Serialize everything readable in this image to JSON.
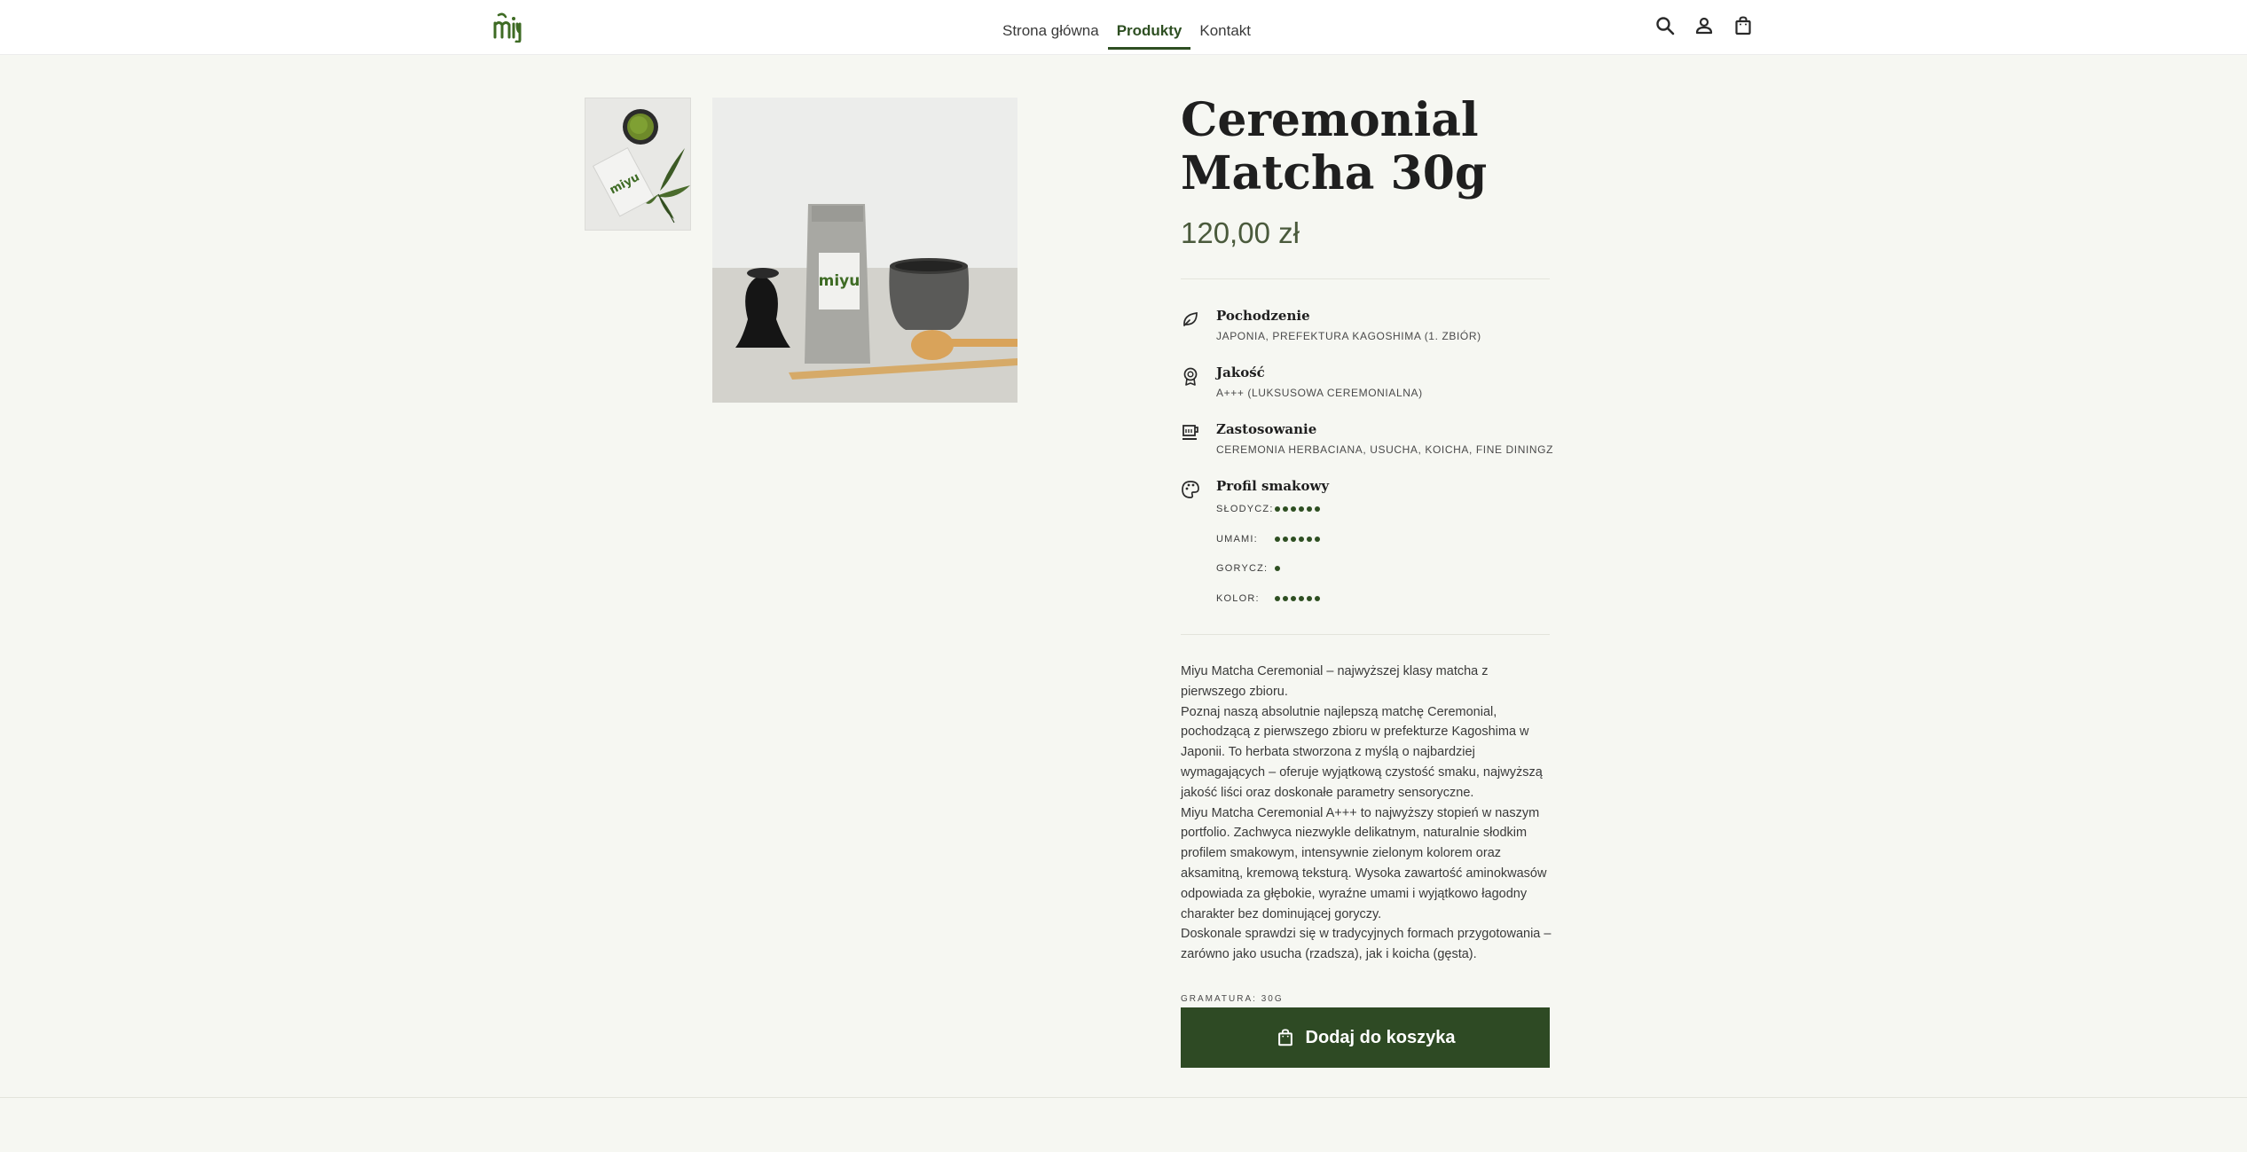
{
  "header": {
    "logo_text": "miyu",
    "nav": [
      {
        "label": "Strona główna",
        "active": false
      },
      {
        "label": "Produkty",
        "active": true
      },
      {
        "label": "Kontakt",
        "active": false
      }
    ],
    "icons": [
      "search-icon",
      "account-icon",
      "cart-icon"
    ]
  },
  "gallery": {
    "thumbnail_icon": "product-photo-thumbnail",
    "main_image_icon": "product-photo-main"
  },
  "product": {
    "title": "Ceremonial Matcha 30g",
    "price": "120,00 zł",
    "features": [
      {
        "icon": "leaf-icon",
        "name": "Pochodzenie",
        "value": "JAPONIA, PREFEKTURA KAGOSHIMA (1. ZBIÓR)"
      },
      {
        "icon": "award-icon",
        "name": "Jakość",
        "value": "A+++ (LUKSUSOWA CEREMONIALNA)"
      },
      {
        "icon": "tea-cup-icon",
        "name": "Zastosowanie",
        "value": "CEREMONIA HERBACIANA, USUCHA, KOICHA, FINE DININGZ"
      }
    ],
    "taste_profile": {
      "icon": "palette-icon",
      "title": "Profil smakowy",
      "scale_max": 6,
      "items": [
        {
          "label": "SŁODYCZ:",
          "level": 6
        },
        {
          "label": "UMAMI:",
          "level": 6
        },
        {
          "label": "GORYCZ:",
          "level": 1
        },
        {
          "label": "KOLOR:",
          "level": 6
        }
      ]
    },
    "description": [
      "Miyu Matcha Ceremonial – najwyższej klasy matcha z pierwszego zbioru.",
      "Poznaj naszą absolutnie najlepszą matchę Ceremonial, pochodzącą z pierwszego zbioru w prefekturze Kagoshima w Japonii. To herbata stworzona z myślą o najbardziej wymagających – oferuje wyjątkową czystość smaku, najwyższą jakość liści oraz doskonałe parametry sensoryczne.",
      "Miyu Matcha Ceremonial A+++ to najwyższy stopień w naszym portfolio. Zachwyca niezwykle delikatnym, naturalnie słodkim profilem smakowym, intensywnie zielonym kolorem oraz aksamitną, kremową teksturą. Wysoka zawartość aminokwasów odpowiada za głębokie, wyraźne umami i wyjątkowo łagodny charakter bez dominującej goryczy.",
      "Doskonale sprawdzi się w tradycyjnych formach przygotowania – zarówno jako usucha (rzadsza), jak i koicha (gęsta)."
    ],
    "weight_label": "GRAMATURA: 30G",
    "add_to_cart_label": "Dodaj do koszyka",
    "add_to_cart_icon": "shopping-bag-icon"
  },
  "colors": {
    "accent": "#2e4a24",
    "background": "#f6f7f2",
    "logo_green": "#3e6b24"
  }
}
